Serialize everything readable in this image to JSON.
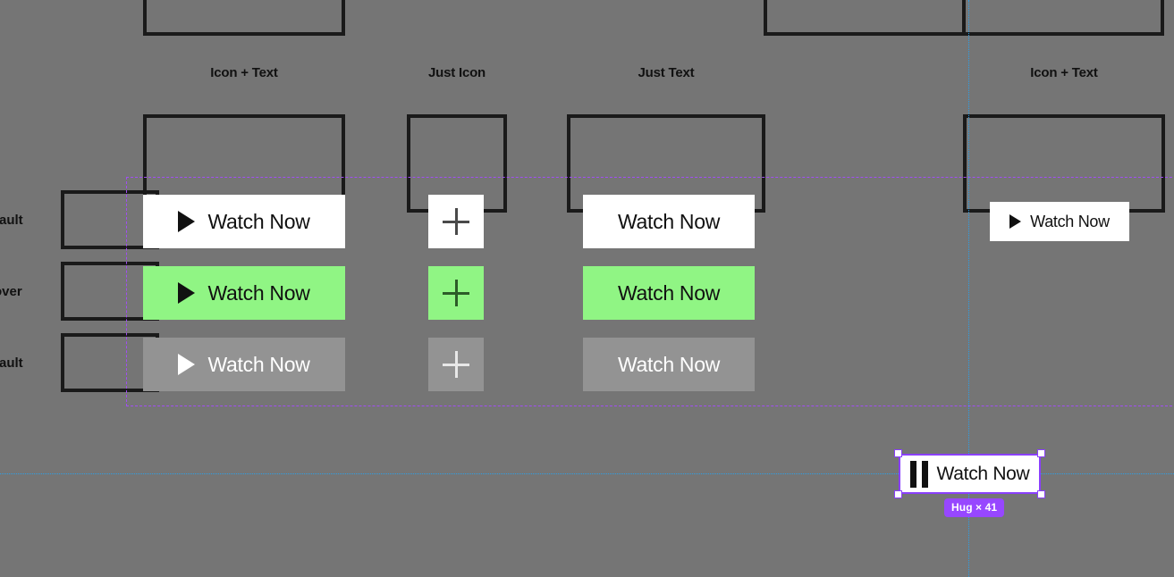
{
  "canvas": {
    "background_color": "#757575",
    "selection_color": "#8a3ffc",
    "region_color": "#a24df5",
    "guide_color": "#2b9fe8"
  },
  "columns": [
    {
      "label": "Icon + Text"
    },
    {
      "label": "Just Icon"
    },
    {
      "label": "Just Text"
    },
    {
      "label": "Icon + Text"
    }
  ],
  "rows": [
    {
      "label": "fault"
    },
    {
      "label": "over"
    },
    {
      "label": "fault"
    }
  ],
  "buttons": {
    "icon_text": [
      {
        "label": "Watch Now",
        "state": "default",
        "icon": "play-icon"
      },
      {
        "label": "Watch Now",
        "state": "hover",
        "icon": "play-icon"
      },
      {
        "label": "Watch Now",
        "state": "disabled",
        "icon": "play-icon"
      }
    ],
    "just_icon": [
      {
        "label": "",
        "state": "default",
        "icon": "plus-icon"
      },
      {
        "label": "",
        "state": "hover",
        "icon": "plus-icon"
      },
      {
        "label": "",
        "state": "disabled",
        "icon": "plus-icon"
      }
    ],
    "just_text": [
      {
        "label": "Watch Now",
        "state": "default",
        "icon": ""
      },
      {
        "label": "Watch Now",
        "state": "hover",
        "icon": ""
      },
      {
        "label": "Watch Now",
        "state": "disabled",
        "icon": ""
      }
    ],
    "right_column": [
      {
        "label": "Watch Now",
        "state": "default",
        "icon": "play-icon"
      }
    ]
  },
  "selected_node": {
    "label": "Watch Now",
    "icon": "pause-icon",
    "size_badge": "Hug × 41"
  },
  "colors": {
    "button_default_bg": "#ffffff",
    "button_hover_bg": "#90f584",
    "button_disabled_bg": "#939393",
    "badge_bg": "#9747ff"
  }
}
